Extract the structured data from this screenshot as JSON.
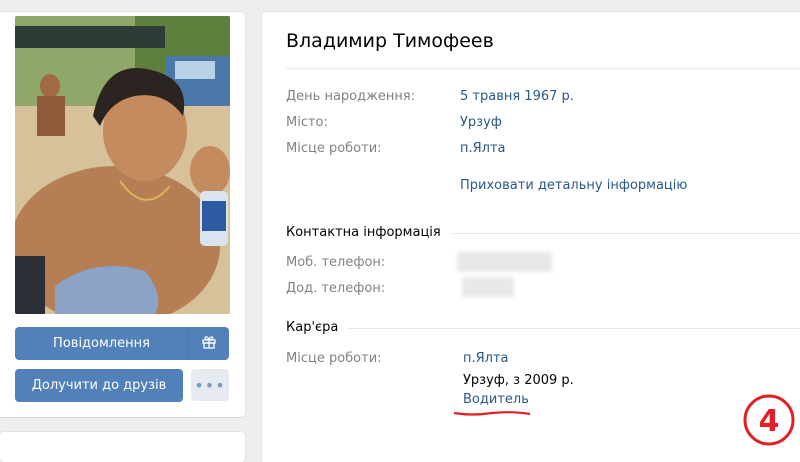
{
  "profile": {
    "name": "Владимир Тимофеев",
    "photo_alt": "",
    "buttons": {
      "message": "Повідомлення",
      "add_friend": "Долучити до друзів",
      "gift_icon": "gift-icon",
      "more": "•••"
    }
  },
  "info": {
    "rows": [
      {
        "label": "День народження:",
        "value": "5 травня 1967 р."
      },
      {
        "label": "Місто:",
        "value": "Урзуф"
      },
      {
        "label": "Місце роботи:",
        "value": "п.Ялта"
      }
    ],
    "hide_details": "Приховати детальну інформацію"
  },
  "contacts": {
    "title": "Контактна інформація",
    "mobile_label": "Моб. телефон:",
    "home_label": "Дод. телефон:"
  },
  "career": {
    "title": "Кар'єра",
    "label": "Місце роботи:",
    "place": "п.Ялта",
    "city_years": "Урзуф, з 2009 р.",
    "position": "Водитель"
  },
  "watermark": {
    "text": "4",
    "color": "#e31e24"
  },
  "colors": {
    "button_blue": "#5181b8",
    "link": "#2a5885",
    "label_gray": "#828282",
    "background": "#edeef0"
  }
}
